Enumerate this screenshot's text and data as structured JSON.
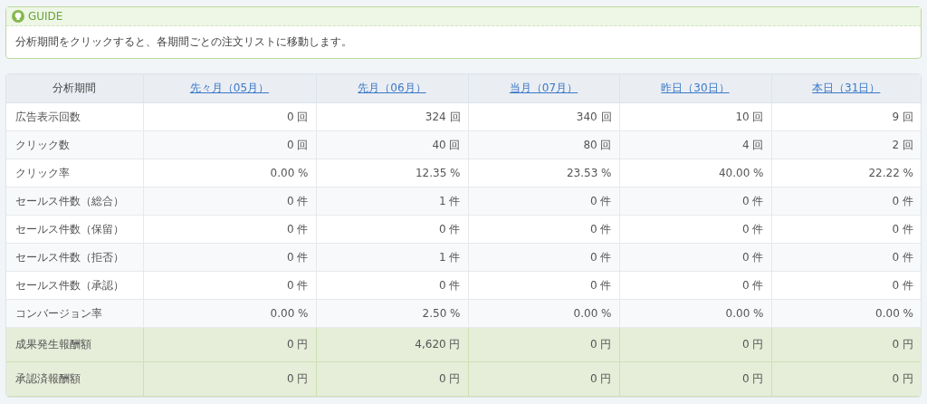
{
  "guide": {
    "title": "GUIDE",
    "message": "分析期間をクリックすると、各期間ごとの注文リストに移動します。"
  },
  "table": {
    "columns": [
      "分析期間",
      "先々月（05月）",
      "先月（06月）",
      "当月（07月）",
      "昨日（30日）",
      "本日（31日）"
    ],
    "rows": [
      {
        "kind": "normal",
        "cells": [
          "広告表示回数",
          "0 回",
          "324 回",
          "340 回",
          "10 回",
          "9 回"
        ]
      },
      {
        "kind": "normal",
        "cells": [
          "クリック数",
          "0 回",
          "40 回",
          "80 回",
          "4 回",
          "2 回"
        ]
      },
      {
        "kind": "normal",
        "cells": [
          "クリック率",
          "0.00 %",
          "12.35 %",
          "23.53 %",
          "40.00 %",
          "22.22 %"
        ]
      },
      {
        "kind": "normal",
        "cells": [
          "セールス件数（総合）",
          "0 件",
          "1 件",
          "0 件",
          "0 件",
          "0 件"
        ]
      },
      {
        "kind": "normal",
        "cells": [
          "セールス件数（保留）",
          "0 件",
          "0 件",
          "0 件",
          "0 件",
          "0 件"
        ]
      },
      {
        "kind": "normal",
        "cells": [
          "セールス件数（拒否）",
          "0 件",
          "1 件",
          "0 件",
          "0 件",
          "0 件"
        ]
      },
      {
        "kind": "normal",
        "cells": [
          "セールス件数（承認）",
          "0 件",
          "0 件",
          "0 件",
          "0 件",
          "0 件"
        ]
      },
      {
        "kind": "normal",
        "cells": [
          "コンバージョン率",
          "0.00 %",
          "2.50 %",
          "0.00 %",
          "0.00 %",
          "0.00 %"
        ]
      },
      {
        "kind": "reward",
        "cells": [
          "成果発生報酬額",
          "0 円",
          "4,620 円",
          "0 円",
          "0 円",
          "0 円"
        ]
      },
      {
        "kind": "reward",
        "cells": [
          "承認済報酬額",
          "0 円",
          "0 円",
          "0 円",
          "0 円",
          "0 円"
        ]
      }
    ]
  }
}
